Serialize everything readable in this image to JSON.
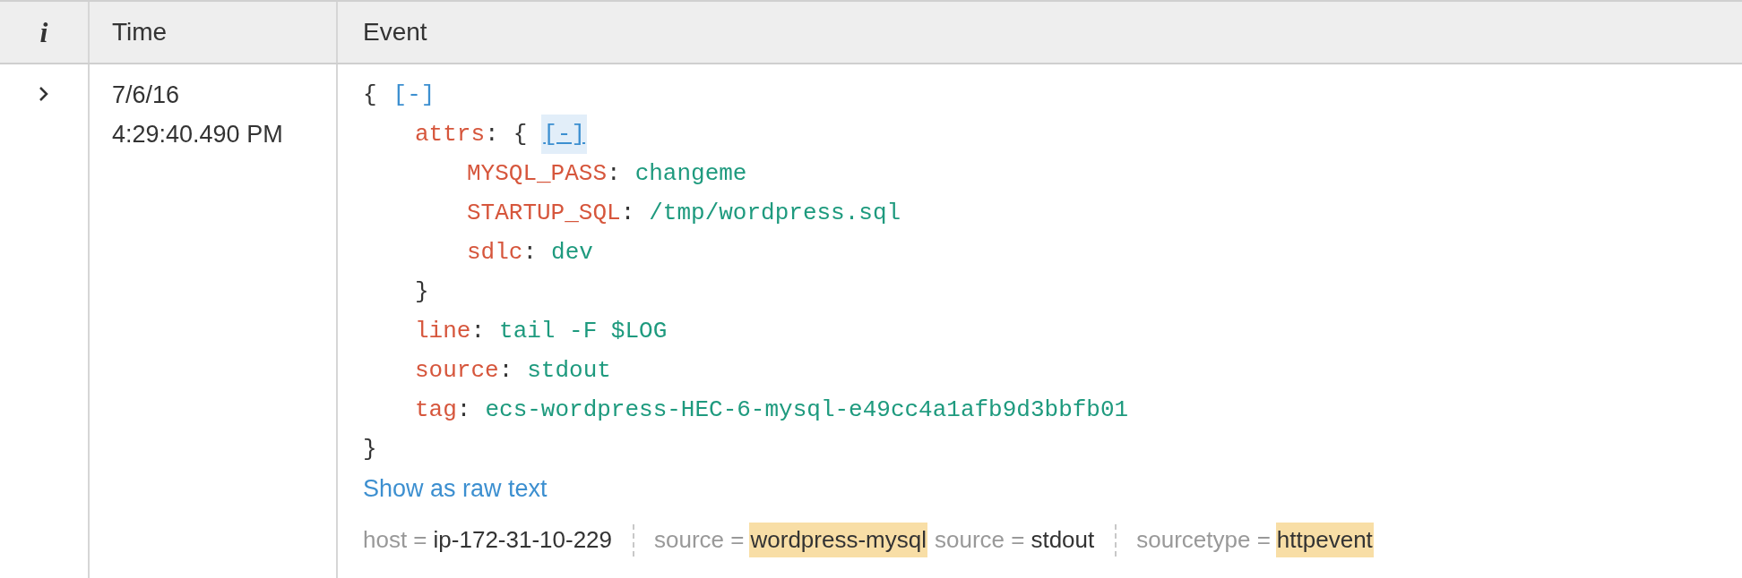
{
  "table": {
    "columns": [
      {
        "label": "i"
      },
      {
        "label": "Time"
      },
      {
        "label": "Event"
      }
    ],
    "rows": [
      {
        "expanded": false,
        "time": [
          "7/6/16",
          "4:29:40.490 PM"
        ],
        "event": {
          "open": "{",
          "toggle": {
            "label": "[-]",
            "hovered": false
          },
          "close": "}",
          "entries": [
            {
              "key": "attrs",
              "colon": ":",
              "open": "{",
              "toggle": {
                "label": "[-]",
                "hovered": true
              },
              "close": "}",
              "children": [
                {
                  "key": "MYSQL_PASS",
                  "colon": ":",
                  "value": "changeme"
                },
                {
                  "key": "STARTUP_SQL",
                  "colon": ":",
                  "value": "/tmp/wordpress.sql"
                },
                {
                  "key": "sdlc",
                  "colon": ":",
                  "value": "dev"
                }
              ]
            },
            {
              "key": "line",
              "colon": ":",
              "value": "tail -F $LOG"
            },
            {
              "key": "source",
              "colon": ":",
              "value": "stdout"
            },
            {
              "key": "tag",
              "colon": ":",
              "value": "ecs-wordpress-HEC-6-mysql-e49cc4a1afb9d3bbfb01"
            }
          ]
        },
        "raw_link": "Show as raw text",
        "field_groups": [
          [
            {
              "name": "host =",
              "value": "ip-172-31-10-229",
              "highlighted": false
            }
          ],
          [
            {
              "name": "source =",
              "value": "wordpress-mysql",
              "highlighted": true
            },
            {
              "name": "source =",
              "value": "stdout",
              "highlighted": false
            }
          ],
          [
            {
              "name": "sourcetype =",
              "value": "httpevent",
              "highlighted": true
            }
          ]
        ]
      }
    ]
  }
}
